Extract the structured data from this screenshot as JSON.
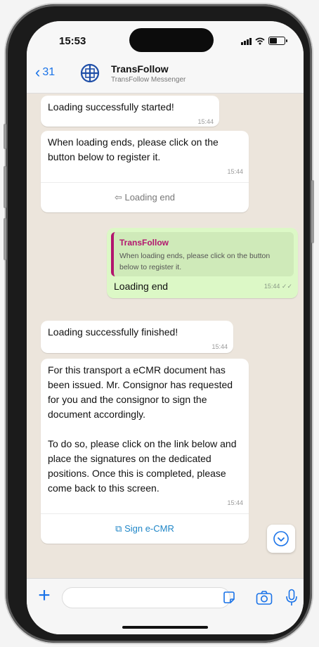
{
  "status_bar": {
    "time": "15:53"
  },
  "header": {
    "back_count": "31",
    "name": "TransFollow",
    "subtitle": "TransFollow Messenger"
  },
  "messages": [
    {
      "direction": "in",
      "text": "Loading successfully started!",
      "time": "15:44"
    },
    {
      "direction": "in",
      "text": "When loading ends, please click on the button below to register it.",
      "time": "15:44",
      "button": "Loading end",
      "button_icon": "reply-icon"
    },
    {
      "direction": "out",
      "quote_name": "TransFollow",
      "quote_text": "When loading ends, please click on the button below to register it.",
      "text": "Loading end",
      "time": "15:44",
      "status": "✓✓"
    },
    {
      "direction": "in",
      "text": "Loading successfully finished!",
      "time": "15:44"
    },
    {
      "direction": "in",
      "text": "For this transport a eCMR document has been issued. Mr. Consignor has requested for you and the consignor to sign the document accordingly.\n\nTo do so, please click on the link below and place the signatures on the dedicated positions. Once this is completed, please come back to this screen.",
      "time": "15:44",
      "button": "Sign e-CMR",
      "button_icon": "external-link-icon"
    }
  ],
  "input": {
    "placeholder": ""
  },
  "colors": {
    "accent": "#1a73e8",
    "incoming_bubble": "#ffffff",
    "outgoing_bubble": "#dcf8c6",
    "quote_accent": "#b2166e",
    "chat_background": "#ece5dc"
  }
}
